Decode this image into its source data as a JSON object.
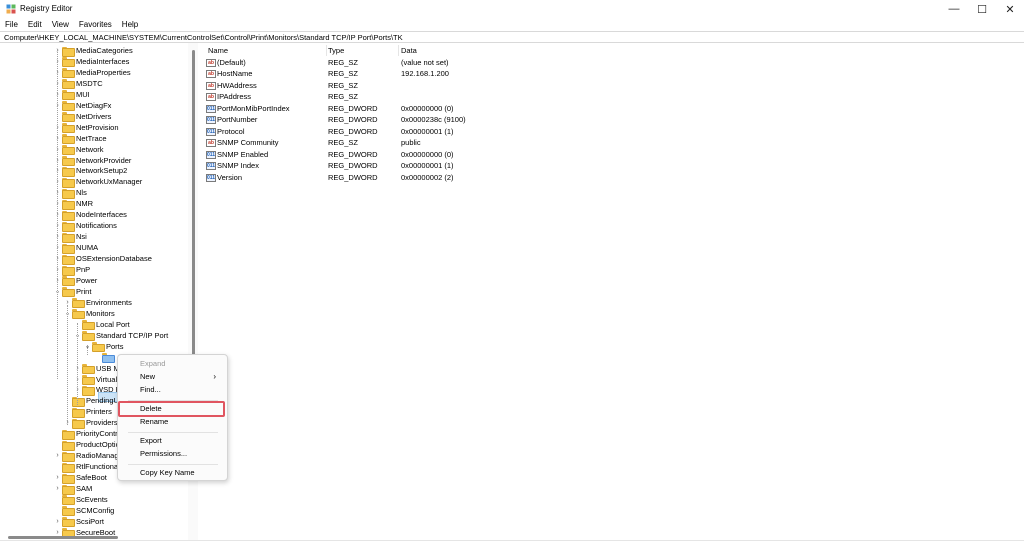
{
  "window": {
    "title": "Registry Editor"
  },
  "menu": [
    "File",
    "Edit",
    "View",
    "Favorites",
    "Help"
  ],
  "address": "Computer\\HKEY_LOCAL_MACHINE\\SYSTEM\\CurrentControlSet\\Control\\Print\\Monitors\\Standard TCP/IP Port\\Ports\\TK",
  "tree": [
    {
      "label": "MediaCategories",
      "level": 0,
      "exp": "collapsed"
    },
    {
      "label": "MediaInterfaces",
      "level": 0,
      "exp": "collapsed"
    },
    {
      "label": "MediaProperties",
      "level": 0,
      "exp": "collapsed"
    },
    {
      "label": "MSDTC",
      "level": 0,
      "exp": "collapsed"
    },
    {
      "label": "MUI",
      "level": 0,
      "exp": "collapsed"
    },
    {
      "label": "NetDiagFx",
      "level": 0,
      "exp": "collapsed"
    },
    {
      "label": "NetDrivers",
      "level": 0,
      "exp": "none"
    },
    {
      "label": "NetProvision",
      "level": 0,
      "exp": "collapsed"
    },
    {
      "label": "NetTrace",
      "level": 0,
      "exp": "collapsed"
    },
    {
      "label": "Network",
      "level": 0,
      "exp": "collapsed"
    },
    {
      "label": "NetworkProvider",
      "level": 0,
      "exp": "collapsed"
    },
    {
      "label": "NetworkSetup2",
      "level": 0,
      "exp": "collapsed"
    },
    {
      "label": "NetworkUxManager",
      "level": 0,
      "exp": "collapsed"
    },
    {
      "label": "Nls",
      "level": 0,
      "exp": "collapsed"
    },
    {
      "label": "NMR",
      "level": 0,
      "exp": "collapsed"
    },
    {
      "label": "NodeInterfaces",
      "level": 0,
      "exp": "collapsed"
    },
    {
      "label": "Notifications",
      "level": 0,
      "exp": "collapsed"
    },
    {
      "label": "Nsi",
      "level": 0,
      "exp": "collapsed"
    },
    {
      "label": "NUMA",
      "level": 0,
      "exp": "collapsed"
    },
    {
      "label": "OSExtensionDatabase",
      "level": 0,
      "exp": "collapsed"
    },
    {
      "label": "PnP",
      "level": 0,
      "exp": "collapsed"
    },
    {
      "label": "Power",
      "level": 0,
      "exp": "collapsed"
    },
    {
      "label": "Print",
      "level": 0,
      "exp": "expanded"
    },
    {
      "label": "Environments",
      "level": 1,
      "exp": "collapsed"
    },
    {
      "label": "Monitors",
      "level": 1,
      "exp": "expanded"
    },
    {
      "label": "Local Port",
      "level": 2,
      "exp": "none"
    },
    {
      "label": "Standard TCP/IP Port",
      "level": 2,
      "exp": "expanded"
    },
    {
      "label": "Ports",
      "level": 3,
      "exp": "expanded"
    },
    {
      "label": "TK",
      "level": 4,
      "exp": "none",
      "selected": true
    },
    {
      "label": "USB Mo",
      "level": 2,
      "exp": "collapsed"
    },
    {
      "label": "Virtual",
      "level": 2,
      "exp": "collapsed"
    },
    {
      "label": "WSD Po",
      "level": 2,
      "exp": "collapsed"
    },
    {
      "label": "PendingUp",
      "level": 1,
      "exp": "none"
    },
    {
      "label": "Printers",
      "level": 1,
      "exp": "none"
    },
    {
      "label": "Providers",
      "level": 1,
      "exp": "collapsed"
    },
    {
      "label": "PriorityContro",
      "level": 0,
      "exp": "none"
    },
    {
      "label": "ProductOptio",
      "level": 0,
      "exp": "none"
    },
    {
      "label": "RadioManage",
      "level": 0,
      "exp": "collapsed"
    },
    {
      "label": "RtlFunctional",
      "level": 0,
      "exp": "none"
    },
    {
      "label": "SafeBoot",
      "level": 0,
      "exp": "collapsed"
    },
    {
      "label": "SAM",
      "level": 0,
      "exp": "collapsed"
    },
    {
      "label": "ScEvents",
      "level": 0,
      "exp": "none"
    },
    {
      "label": "SCMConfig",
      "level": 0,
      "exp": "none"
    },
    {
      "label": "ScsiPort",
      "level": 0,
      "exp": "collapsed"
    },
    {
      "label": "SecureBoot",
      "level": 0,
      "exp": "collapsed"
    }
  ],
  "columns": {
    "name": "Name",
    "type": "Type",
    "data": "Data"
  },
  "values": [
    {
      "name": "(Default)",
      "type": "REG_SZ",
      "data": "(value not set)",
      "kind": "sz"
    },
    {
      "name": "HostName",
      "type": "REG_SZ",
      "data": "192.168.1.200",
      "kind": "sz"
    },
    {
      "name": "HWAddress",
      "type": "REG_SZ",
      "data": "",
      "kind": "sz"
    },
    {
      "name": "IPAddress",
      "type": "REG_SZ",
      "data": "",
      "kind": "sz"
    },
    {
      "name": "PortMonMibPortIndex",
      "type": "REG_DWORD",
      "data": "0x00000000 (0)",
      "kind": "dword"
    },
    {
      "name": "PortNumber",
      "type": "REG_DWORD",
      "data": "0x0000238c (9100)",
      "kind": "dword"
    },
    {
      "name": "Protocol",
      "type": "REG_DWORD",
      "data": "0x00000001 (1)",
      "kind": "dword"
    },
    {
      "name": "SNMP Community",
      "type": "REG_SZ",
      "data": "public",
      "kind": "sz"
    },
    {
      "name": "SNMP Enabled",
      "type": "REG_DWORD",
      "data": "0x00000000 (0)",
      "kind": "dword"
    },
    {
      "name": "SNMP Index",
      "type": "REG_DWORD",
      "data": "0x00000001 (1)",
      "kind": "dword"
    },
    {
      "name": "Version",
      "type": "REG_DWORD",
      "data": "0x00000002 (2)",
      "kind": "dword"
    }
  ],
  "context_menu": {
    "expand": "Expand",
    "new": "New",
    "find": "Find...",
    "delete": "Delete",
    "rename": "Rename",
    "export": "Export",
    "permissions": "Permissions...",
    "copy_key_name": "Copy Key Name"
  },
  "icons": {
    "sz_glyph": "ab",
    "dword_glyph": "011",
    "submenu_arrow": "›",
    "chevron_collapsed": "›",
    "chevron_expanded": "⌄",
    "minimize": "—",
    "maximize": "☐",
    "close": "✕"
  },
  "colors": {
    "highlight_box": "#e05560",
    "folder": "#f6c94c",
    "selection": "#cce4f7"
  }
}
